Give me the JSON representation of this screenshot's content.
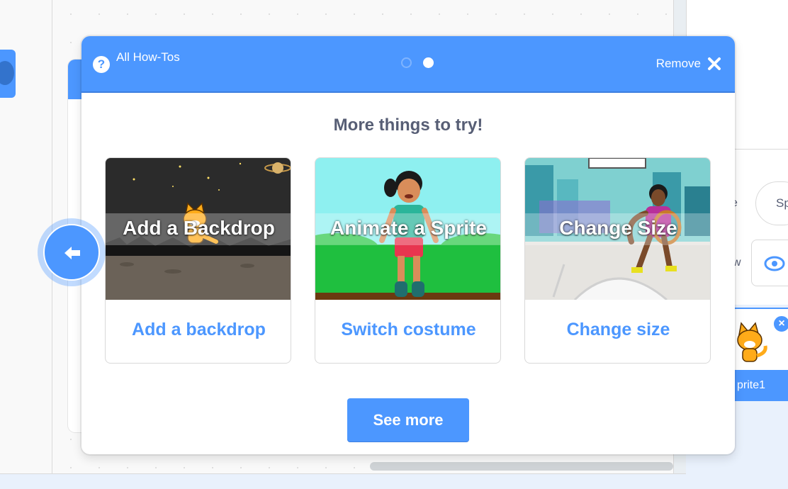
{
  "howto_card": {
    "all_howtos_label": "All How-Tos",
    "help_icon": "question-mark-icon",
    "step_indicator": {
      "total": 2,
      "current": 2
    },
    "remove_label": "Remove",
    "title": "More things to try!",
    "tiles": [
      {
        "overlay": "Add a Backdrop",
        "caption": "Add a backdrop"
      },
      {
        "overlay": "Animate a Sprite",
        "caption": "Switch costume"
      },
      {
        "overlay": "Change Size",
        "caption": "Change size"
      }
    ],
    "see_more_label": "See more",
    "back_icon": "arrow-left-icon"
  },
  "sprite_panel": {
    "sprite_name_partial": "Sp",
    "sprite_label_partial": "prite1",
    "label_fragment_1": "e",
    "label_fragment_2": "w"
  },
  "colors": {
    "accent": "#4c97ff",
    "accent_dark": "#3d7fe0",
    "text_gray": "#575e75"
  }
}
